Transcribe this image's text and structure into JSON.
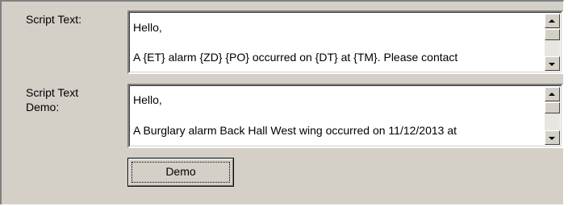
{
  "fields": {
    "script_text": {
      "label": "Script Text:",
      "line1": "Hello,",
      "line2": "A {ET} alarm {ZD} {PO} occurred on {DT} at {TM}. Please contact"
    },
    "script_text_demo": {
      "label_line1": "Script Text",
      "label_line2": "Demo:",
      "line1": "Hello,",
      "line2": "A Burglary alarm Back Hall West wing occurred on 11/12/2013 at"
    }
  },
  "buttons": {
    "demo_label": "Demo"
  }
}
